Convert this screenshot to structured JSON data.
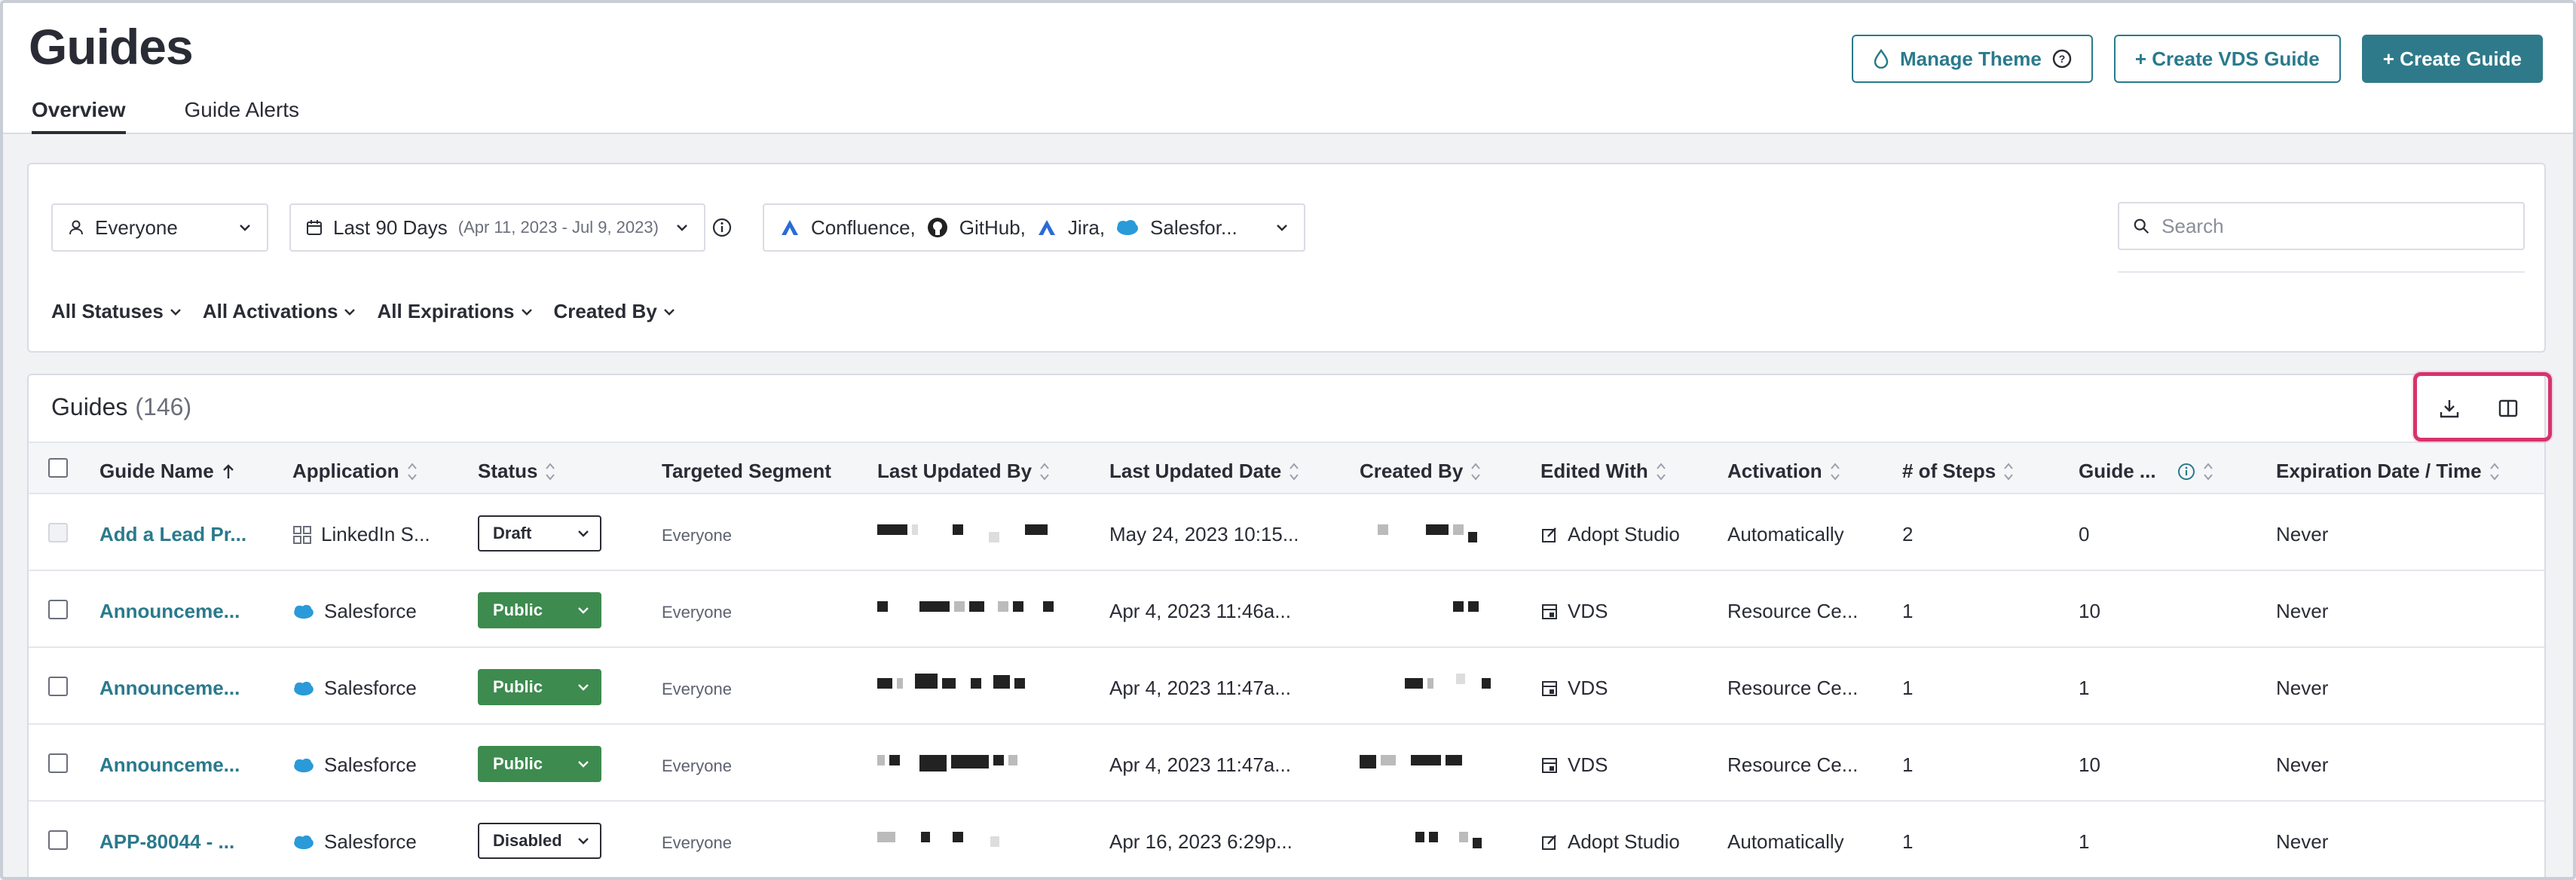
{
  "header": {
    "title": "Guides",
    "tabs": [
      {
        "label": "Overview",
        "active": true
      },
      {
        "label": "Guide Alerts",
        "active": false
      }
    ],
    "buttons": {
      "manage_theme": "Manage Theme",
      "create_vds": "+ Create VDS Guide",
      "create_guide": "+ Create Guide"
    }
  },
  "filters": {
    "segment": "Everyone",
    "date_range": "Last 90 Days",
    "date_detail": "(Apr 11, 2023 - Jul 9, 2023)",
    "apps": [
      "Confluence,",
      "GitHub,",
      "Jira,",
      "Salesfor..."
    ],
    "search_placeholder": "Search",
    "dropdowns": [
      "All Statuses",
      "All Activations",
      "All Expirations",
      "Created By"
    ]
  },
  "table": {
    "title": "Guides",
    "count": "(146)",
    "columns": [
      "Guide Name",
      "Application",
      "Status",
      "Targeted Segment",
      "Last Updated By",
      "Last Updated Date",
      "Created By",
      "Edited With",
      "Activation",
      "# of Steps",
      "Guide ...",
      "Expiration Date / Time"
    ],
    "rows": [
      {
        "name": "Add a Lead Pr...",
        "app": "LinkedIn S...",
        "app_icon": "grid-icon",
        "status": "Draft",
        "segment": "Everyone",
        "updated_date": "May 24, 2023 10:15...",
        "edited_with": "Adopt Studio",
        "editor_icon": "edit-icon",
        "activation": "Automatically",
        "steps": "2",
        "guide_val": "0",
        "expiration": "Never",
        "checkbox_disabled": true
      },
      {
        "name": "Announceme...",
        "app": "Salesforce",
        "app_icon": "salesforce-icon",
        "status": "Public",
        "segment": "Everyone",
        "updated_date": "Apr 4, 2023 11:46a...",
        "edited_with": "VDS",
        "editor_icon": "vds-icon",
        "activation": "Resource Ce...",
        "steps": "1",
        "guide_val": "10",
        "expiration": "Never",
        "checkbox_disabled": false
      },
      {
        "name": "Announceme...",
        "app": "Salesforce",
        "app_icon": "salesforce-icon",
        "status": "Public",
        "segment": "Everyone",
        "updated_date": "Apr 4, 2023 11:47a...",
        "edited_with": "VDS",
        "editor_icon": "vds-icon",
        "activation": "Resource Ce...",
        "steps": "1",
        "guide_val": "1",
        "expiration": "Never",
        "checkbox_disabled": false
      },
      {
        "name": "Announceme...",
        "app": "Salesforce",
        "app_icon": "salesforce-icon",
        "status": "Public",
        "segment": "Everyone",
        "updated_date": "Apr 4, 2023 11:47a...",
        "edited_with": "VDS",
        "editor_icon": "vds-icon",
        "activation": "Resource Ce...",
        "steps": "1",
        "guide_val": "10",
        "expiration": "Never",
        "checkbox_disabled": false
      },
      {
        "name": "APP-80044 - ...",
        "app": "Salesforce",
        "app_icon": "salesforce-icon",
        "status": "Disabled",
        "segment": "Everyone",
        "updated_date": "Apr 16, 2023 6:29p...",
        "edited_with": "Adopt Studio",
        "editor_icon": "edit-icon",
        "activation": "Automatically",
        "steps": "1",
        "guide_val": "1",
        "expiration": "Never",
        "checkbox_disabled": false
      }
    ]
  },
  "colors": {
    "accent": "#2a7a8c",
    "public": "#3d8b4f",
    "highlight": "#d6336c"
  }
}
